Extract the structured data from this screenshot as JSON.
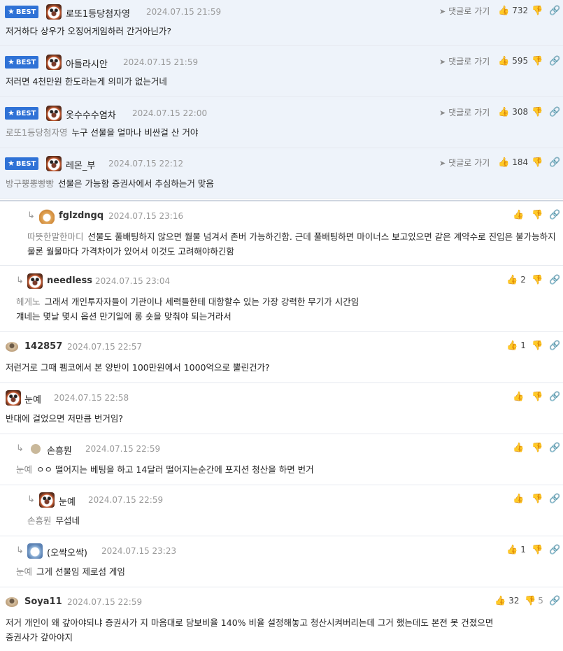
{
  "icons": {
    "reply_arrow": "reply-arrow-icon",
    "thumb_up": "thumb-up-icon",
    "thumb_down": "thumb-down-icon",
    "link": "link-icon",
    "star": "star-icon"
  },
  "colors": {
    "best_badge": "#2f72d6",
    "best_bg": "#eef3fa",
    "mention": "#888888",
    "date": "#999999"
  },
  "labels": {
    "best": "BEST",
    "reply_to": "댓글로 가기"
  },
  "comments": [
    {
      "best": true,
      "nick": "로또1등당첨자영",
      "date": "2024.07.15 21:59",
      "up": "732",
      "text": "저거하다 상우가 오징어게임하러 간거아닌가?"
    },
    {
      "best": true,
      "nick": "아틀라시안",
      "date": "2024.07.15 21:59",
      "up": "595",
      "text": "저러면 4천만원 한도라는게 의미가 없는거네"
    },
    {
      "best": true,
      "nick": "옷수수수염차",
      "date": "2024.07.15 22:00",
      "up": "308",
      "mention": "로또1등당첨자영",
      "text": "누구 선물을 얼마나 비싼걸 산 거야"
    },
    {
      "best": true,
      "nick": "레몬_부",
      "date": "2024.07.15 22:12",
      "up": "184",
      "mention": "방구뿡뿡빵빵",
      "text": "선물은 가능함 증권사에서 추심하는거 맞음"
    },
    {
      "nick": "fglzdngq",
      "date": "2024.07.15 23:16",
      "mention": "따뜻한말한마디",
      "text": "선물도 풀배팅하지 않으면 월물 넘겨서 존버 가능하긴함. 근데 풀배팅하면 마이너스 보고있으면 같은 계약수로 진입은 불가능하지 물론 월물마다 가격차이가 있어서 이것도 고려해야하긴함"
    },
    {
      "nick": "needless",
      "date": "2024.07.15 23:04",
      "up": "2",
      "mention": "헤게노",
      "text": "그래서 개인투자자들이 기관이나 세력들한테 대항할수 있는 가장 강력한 무기가 시간임",
      "text2": "걔네는 몇날 몇시 옵션 만기일에 롱 숏을 맞춰야 되는거라서"
    },
    {
      "nick": "142857",
      "date": "2024.07.15 22:57",
      "up": "1",
      "text": "저런거로 그때 펨코에서 본 양반이 100만원에서 1000억으로 뿔린건가?"
    },
    {
      "nick": "눈예",
      "date": "2024.07.15 22:58",
      "text": "반대에 걸었으면 저만큼 번거임?"
    },
    {
      "nick": "손흥뭔",
      "date": "2024.07.15 22:59",
      "mention": "눈예",
      "text": "ㅇㅇ 떨어지는 베팅을 하고 14달러 떨어지는순간에 포지션 청산을 하면 번거"
    },
    {
      "nick": "눈예",
      "date": "2024.07.15 22:59",
      "mention": "손흥뭔",
      "text": "무섭네"
    },
    {
      "nick": "(오싹오싹)",
      "date": "2024.07.15 23:23",
      "up": "1",
      "mention": "눈예",
      "text": "그게 선물임 제로섬 게임"
    },
    {
      "nick": "Soya11",
      "date": "2024.07.15 22:59",
      "up": "32",
      "down": "5",
      "text": "저거 개인이 왜 갚아야되냐 증권사가 지 마음대로 담보비율 140% 비율 설정해놓고 청산시켜버리는데 그거 했는데도 본전 못 건졌으면",
      "text2": "증권사가 갚아야지"
    }
  ]
}
